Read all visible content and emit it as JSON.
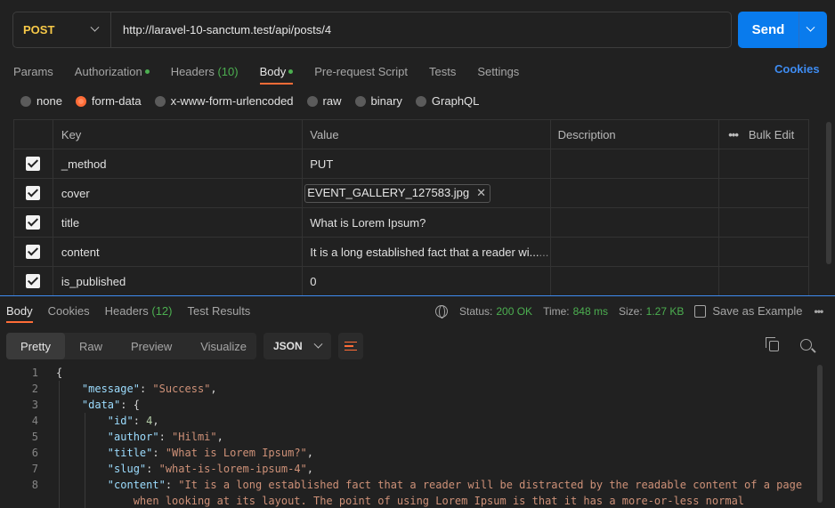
{
  "request": {
    "method": "POST",
    "url": "http://laravel-10-sanctum.test/api/posts/4",
    "send_label": "Send"
  },
  "request_tabs": [
    {
      "label": "Params",
      "count": "",
      "dot": false,
      "active": false
    },
    {
      "label": "Authorization",
      "count": "",
      "dot": true,
      "active": false
    },
    {
      "label": "Headers",
      "count": "(10)",
      "dot": false,
      "active": false
    },
    {
      "label": "Body",
      "count": "",
      "dot": true,
      "active": true
    },
    {
      "label": "Pre-request Script",
      "count": "",
      "dot": false,
      "active": false
    },
    {
      "label": "Tests",
      "count": "",
      "dot": false,
      "active": false
    },
    {
      "label": "Settings",
      "count": "",
      "dot": false,
      "active": false
    }
  ],
  "cookies_link": "Cookies",
  "body_types": [
    {
      "label": "none",
      "checked": false
    },
    {
      "label": "form-data",
      "checked": true
    },
    {
      "label": "x-www-form-urlencoded",
      "checked": false
    },
    {
      "label": "raw",
      "checked": false
    },
    {
      "label": "binary",
      "checked": false
    },
    {
      "label": "GraphQL",
      "checked": false
    }
  ],
  "params_table": {
    "headers": {
      "key": "Key",
      "value": "Value",
      "description": "Description",
      "bulk_edit": "Bulk Edit"
    },
    "rows": [
      {
        "key": "_method",
        "value": "PUT"
      },
      {
        "key": "cover",
        "value": "EVENT_GALLERY_127583.jpg"
      },
      {
        "key": "title",
        "value": "What is Lorem Ipsum?"
      },
      {
        "key": "content",
        "value": "It is a long established fact that a reader wi...",
        "value_fade": "..."
      },
      {
        "key": "is_published",
        "value": "0"
      }
    ]
  },
  "response_tabs": [
    {
      "label": "Body",
      "count": "",
      "active": true
    },
    {
      "label": "Cookies",
      "count": "",
      "active": false
    },
    {
      "label": "Headers",
      "count": "(12)",
      "active": false
    },
    {
      "label": "Test Results",
      "count": "",
      "active": false
    }
  ],
  "response_meta": {
    "status_label": "Status:",
    "status_value": "200 OK",
    "time_label": "Time:",
    "time_value": "848 ms",
    "size_label": "Size:",
    "size_value": "1.27 KB",
    "save_label": "Save as Example"
  },
  "view_tabs": [
    "Pretty",
    "Raw",
    "Preview",
    "Visualize"
  ],
  "format": "JSON",
  "code_lines": [
    {
      "n": "1",
      "parts": [
        {
          "t": "p",
          "v": "{"
        }
      ]
    },
    {
      "n": "2",
      "parts": [
        {
          "t": "p",
          "v": "    "
        },
        {
          "t": "k",
          "v": "\"message\""
        },
        {
          "t": "p",
          "v": ": "
        },
        {
          "t": "s",
          "v": "\"Success\""
        },
        {
          "t": "p",
          "v": ","
        }
      ]
    },
    {
      "n": "3",
      "parts": [
        {
          "t": "p",
          "v": "    "
        },
        {
          "t": "k",
          "v": "\"data\""
        },
        {
          "t": "p",
          "v": ": {"
        }
      ]
    },
    {
      "n": "4",
      "parts": [
        {
          "t": "p",
          "v": "        "
        },
        {
          "t": "k",
          "v": "\"id\""
        },
        {
          "t": "p",
          "v": ": "
        },
        {
          "t": "n",
          "v": "4"
        },
        {
          "t": "p",
          "v": ","
        }
      ]
    },
    {
      "n": "5",
      "parts": [
        {
          "t": "p",
          "v": "        "
        },
        {
          "t": "k",
          "v": "\"author\""
        },
        {
          "t": "p",
          "v": ": "
        },
        {
          "t": "s",
          "v": "\"Hilmi\""
        },
        {
          "t": "p",
          "v": ","
        }
      ]
    },
    {
      "n": "6",
      "parts": [
        {
          "t": "p",
          "v": "        "
        },
        {
          "t": "k",
          "v": "\"title\""
        },
        {
          "t": "p",
          "v": ": "
        },
        {
          "t": "s",
          "v": "\"What is Lorem Ipsum?\""
        },
        {
          "t": "p",
          "v": ","
        }
      ]
    },
    {
      "n": "7",
      "parts": [
        {
          "t": "p",
          "v": "        "
        },
        {
          "t": "k",
          "v": "\"slug\""
        },
        {
          "t": "p",
          "v": ": "
        },
        {
          "t": "s",
          "v": "\"what-is-lorem-ipsum-4\""
        },
        {
          "t": "p",
          "v": ","
        }
      ]
    },
    {
      "n": "8",
      "parts": [
        {
          "t": "p",
          "v": "        "
        },
        {
          "t": "k",
          "v": "\"content\""
        },
        {
          "t": "p",
          "v": ": "
        },
        {
          "t": "s",
          "v": "\"It is a long established fact that a reader will be distracted by the readable content of a page"
        }
      ]
    },
    {
      "n": "",
      "parts": [
        {
          "t": "s",
          "v": "            when looking at its layout. The point of using Lorem Ipsum is that it has a more-or-less normal"
        }
      ]
    }
  ]
}
